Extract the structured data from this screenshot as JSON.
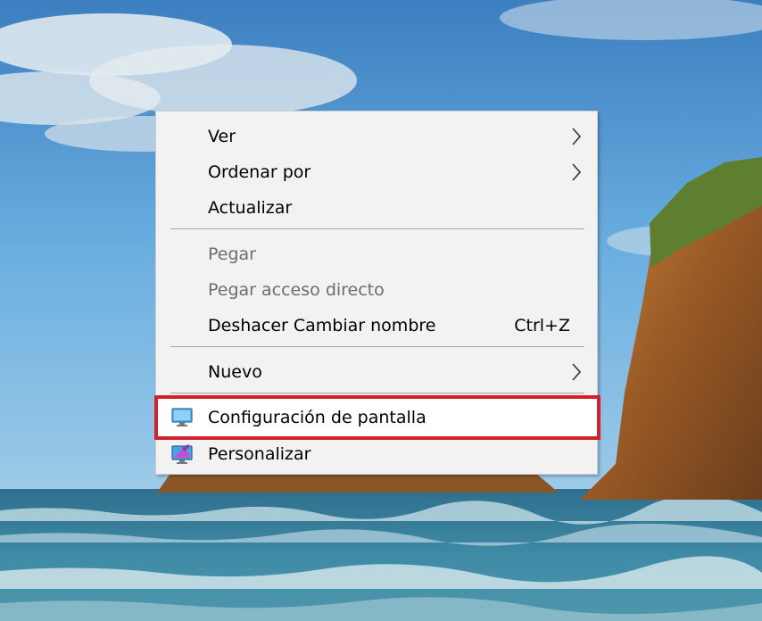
{
  "context_menu": {
    "items": [
      {
        "label": "Ver",
        "has_submenu": true,
        "enabled": true
      },
      {
        "label": "Ordenar por",
        "has_submenu": true,
        "enabled": true
      },
      {
        "label": "Actualizar",
        "has_submenu": false,
        "enabled": true
      },
      {
        "label": "Pegar",
        "has_submenu": false,
        "enabled": false
      },
      {
        "label": "Pegar acceso directo",
        "has_submenu": false,
        "enabled": false
      },
      {
        "label": "Deshacer Cambiar nombre",
        "shortcut": "Ctrl+Z",
        "has_submenu": false,
        "enabled": true
      },
      {
        "label": "Nuevo",
        "has_submenu": true,
        "enabled": true
      },
      {
        "label": "Configuración de pantalla",
        "icon": "display-settings-icon",
        "highlighted": true,
        "enabled": true
      },
      {
        "label": "Personalizar",
        "icon": "personalize-icon",
        "enabled": true
      }
    ]
  },
  "colors": {
    "menu_background": "#f2f2f2",
    "highlight_border": "#d4202a",
    "disabled_text": "#6d6d6d"
  }
}
